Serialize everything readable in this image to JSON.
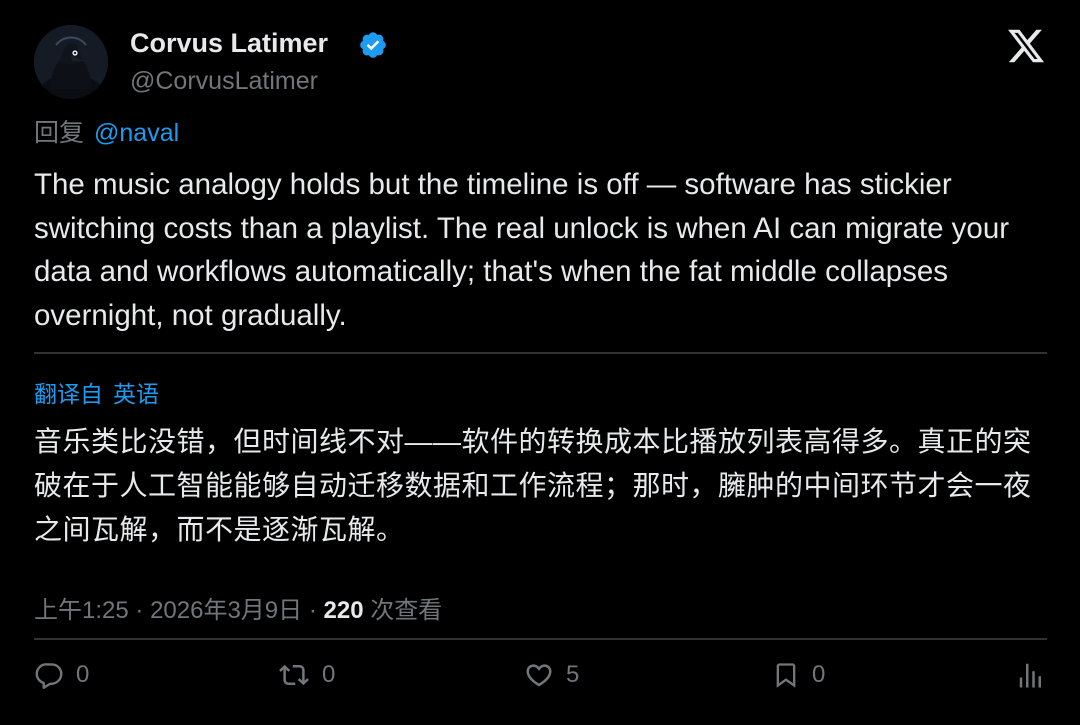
{
  "author": {
    "display_name": "Corvus Latimer",
    "handle": "@CorvusLatimer",
    "verified": true
  },
  "reply": {
    "prefix": "回复",
    "mention": "@naval"
  },
  "tweet": {
    "text": "The music analogy holds but the timeline is off — software has stickier switching costs than a playlist. The real unlock is when AI can migrate your data and workflows automatically; that's when the fat middle collapses overnight, not gradually."
  },
  "translation": {
    "label": "翻译自",
    "language": "英语",
    "text": "音乐类比没错，但时间线不对——软件的转换成本比播放列表高得多。真正的突破在于人工智能能够自动迁移数据和工作流程；那时，臃肿的中间环节才会一夜之间瓦解，而不是逐渐瓦解。"
  },
  "meta": {
    "time": "上午1:25",
    "separator": "·",
    "date": "2026年3月9日",
    "views_count": "220",
    "views_label": "次查看"
  },
  "actions": {
    "reply_count": "0",
    "retweet_count": "0",
    "like_count": "5",
    "bookmark_count": "0"
  },
  "icons": {
    "verified": "verified-badge-icon",
    "logo": "x-logo-icon",
    "reply": "reply-icon",
    "retweet": "retweet-icon",
    "like": "heart-icon",
    "bookmark": "bookmark-icon",
    "views": "analytics-icon"
  },
  "colors": {
    "background": "#000000",
    "text": "#e7e9ea",
    "secondary": "#71767b",
    "accent": "#1d9bf0",
    "divider": "#2f3336"
  }
}
